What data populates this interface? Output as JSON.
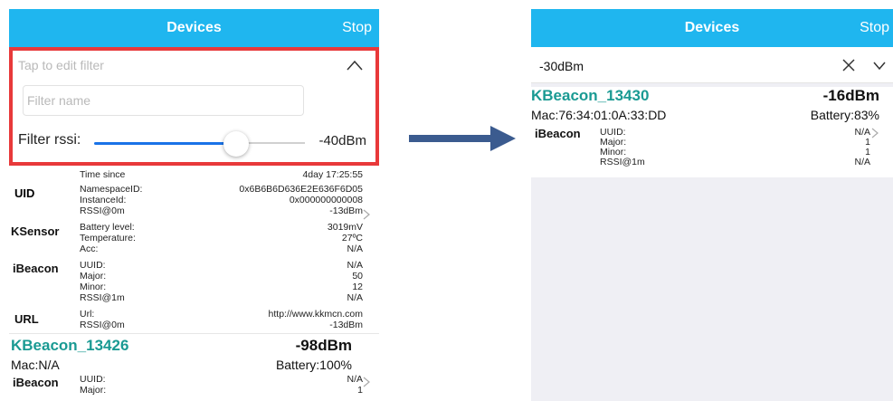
{
  "left": {
    "nav": {
      "title": "Devices",
      "stop_label": "Stop"
    },
    "filter": {
      "hint": "Tap to edit filter",
      "name_placeholder": "Filter name",
      "rssi_label": "Filter rssi:",
      "rssi_value": "-40dBm",
      "slider_fraction": 0.68
    },
    "sections": [
      {
        "name": "",
        "rows": [
          {
            "k": "Time since",
            "v": "4day 17:25:55"
          }
        ]
      },
      {
        "name": "UID",
        "rows": [
          {
            "k": "NamespaceID:",
            "v": "0x6B6B6D636E2E636F6D05"
          },
          {
            "k": "InstanceId:",
            "v": "0x000000000008"
          },
          {
            "k": "RSSI@0m",
            "v": "-13dBm"
          }
        ]
      },
      {
        "name": "KSensor",
        "rows": [
          {
            "k": "Battery level:",
            "v": "3019mV"
          },
          {
            "k": "Temperature:",
            "v": "27ºC"
          },
          {
            "k": "Acc:",
            "v": "N/A"
          }
        ]
      },
      {
        "name": "iBeacon",
        "rows": [
          {
            "k": "UUID:",
            "v": "N/A"
          },
          {
            "k": "Major:",
            "v": "50"
          },
          {
            "k": "Minor:",
            "v": "12"
          },
          {
            "k": "RSSI@1m",
            "v": "N/A"
          }
        ]
      },
      {
        "name": "URL",
        "rows": [
          {
            "k": "Url:",
            "v": "http://www.kkmcn.com"
          },
          {
            "k": "RSSI@0m",
            "v": "-13dBm"
          }
        ]
      }
    ],
    "device2": {
      "name": "KBeacon_13426",
      "rssi": "-98dBm",
      "mac": "Mac:N/A",
      "battery": "Battery:100%",
      "section": "iBeacon",
      "rows": [
        {
          "k": "UUID:",
          "v": "N/A"
        },
        {
          "k": "Major:",
          "v": "1"
        }
      ]
    }
  },
  "right": {
    "nav": {
      "title": "Devices",
      "stop_label": "Stop"
    },
    "search_value": "-30dBm",
    "device": {
      "name": "KBeacon_13430",
      "rssi": "-16dBm",
      "mac": "Mac:76:34:01:0A:33:DD",
      "battery": "Battery:83%",
      "section": "iBeacon",
      "rows": [
        {
          "k": "UUID:",
          "v": "N/A"
        },
        {
          "k": "Major:",
          "v": "1"
        },
        {
          "k": "Minor:",
          "v": "1"
        },
        {
          "k": "RSSI@1m",
          "v": "N/A"
        }
      ]
    }
  },
  "colors": {
    "nav_bg": "#1fb6ef",
    "highlight_border": "#e8393a",
    "device_name": "#1a9a93",
    "arrow": "#3b5b8f",
    "slider": "#1a73e8"
  }
}
